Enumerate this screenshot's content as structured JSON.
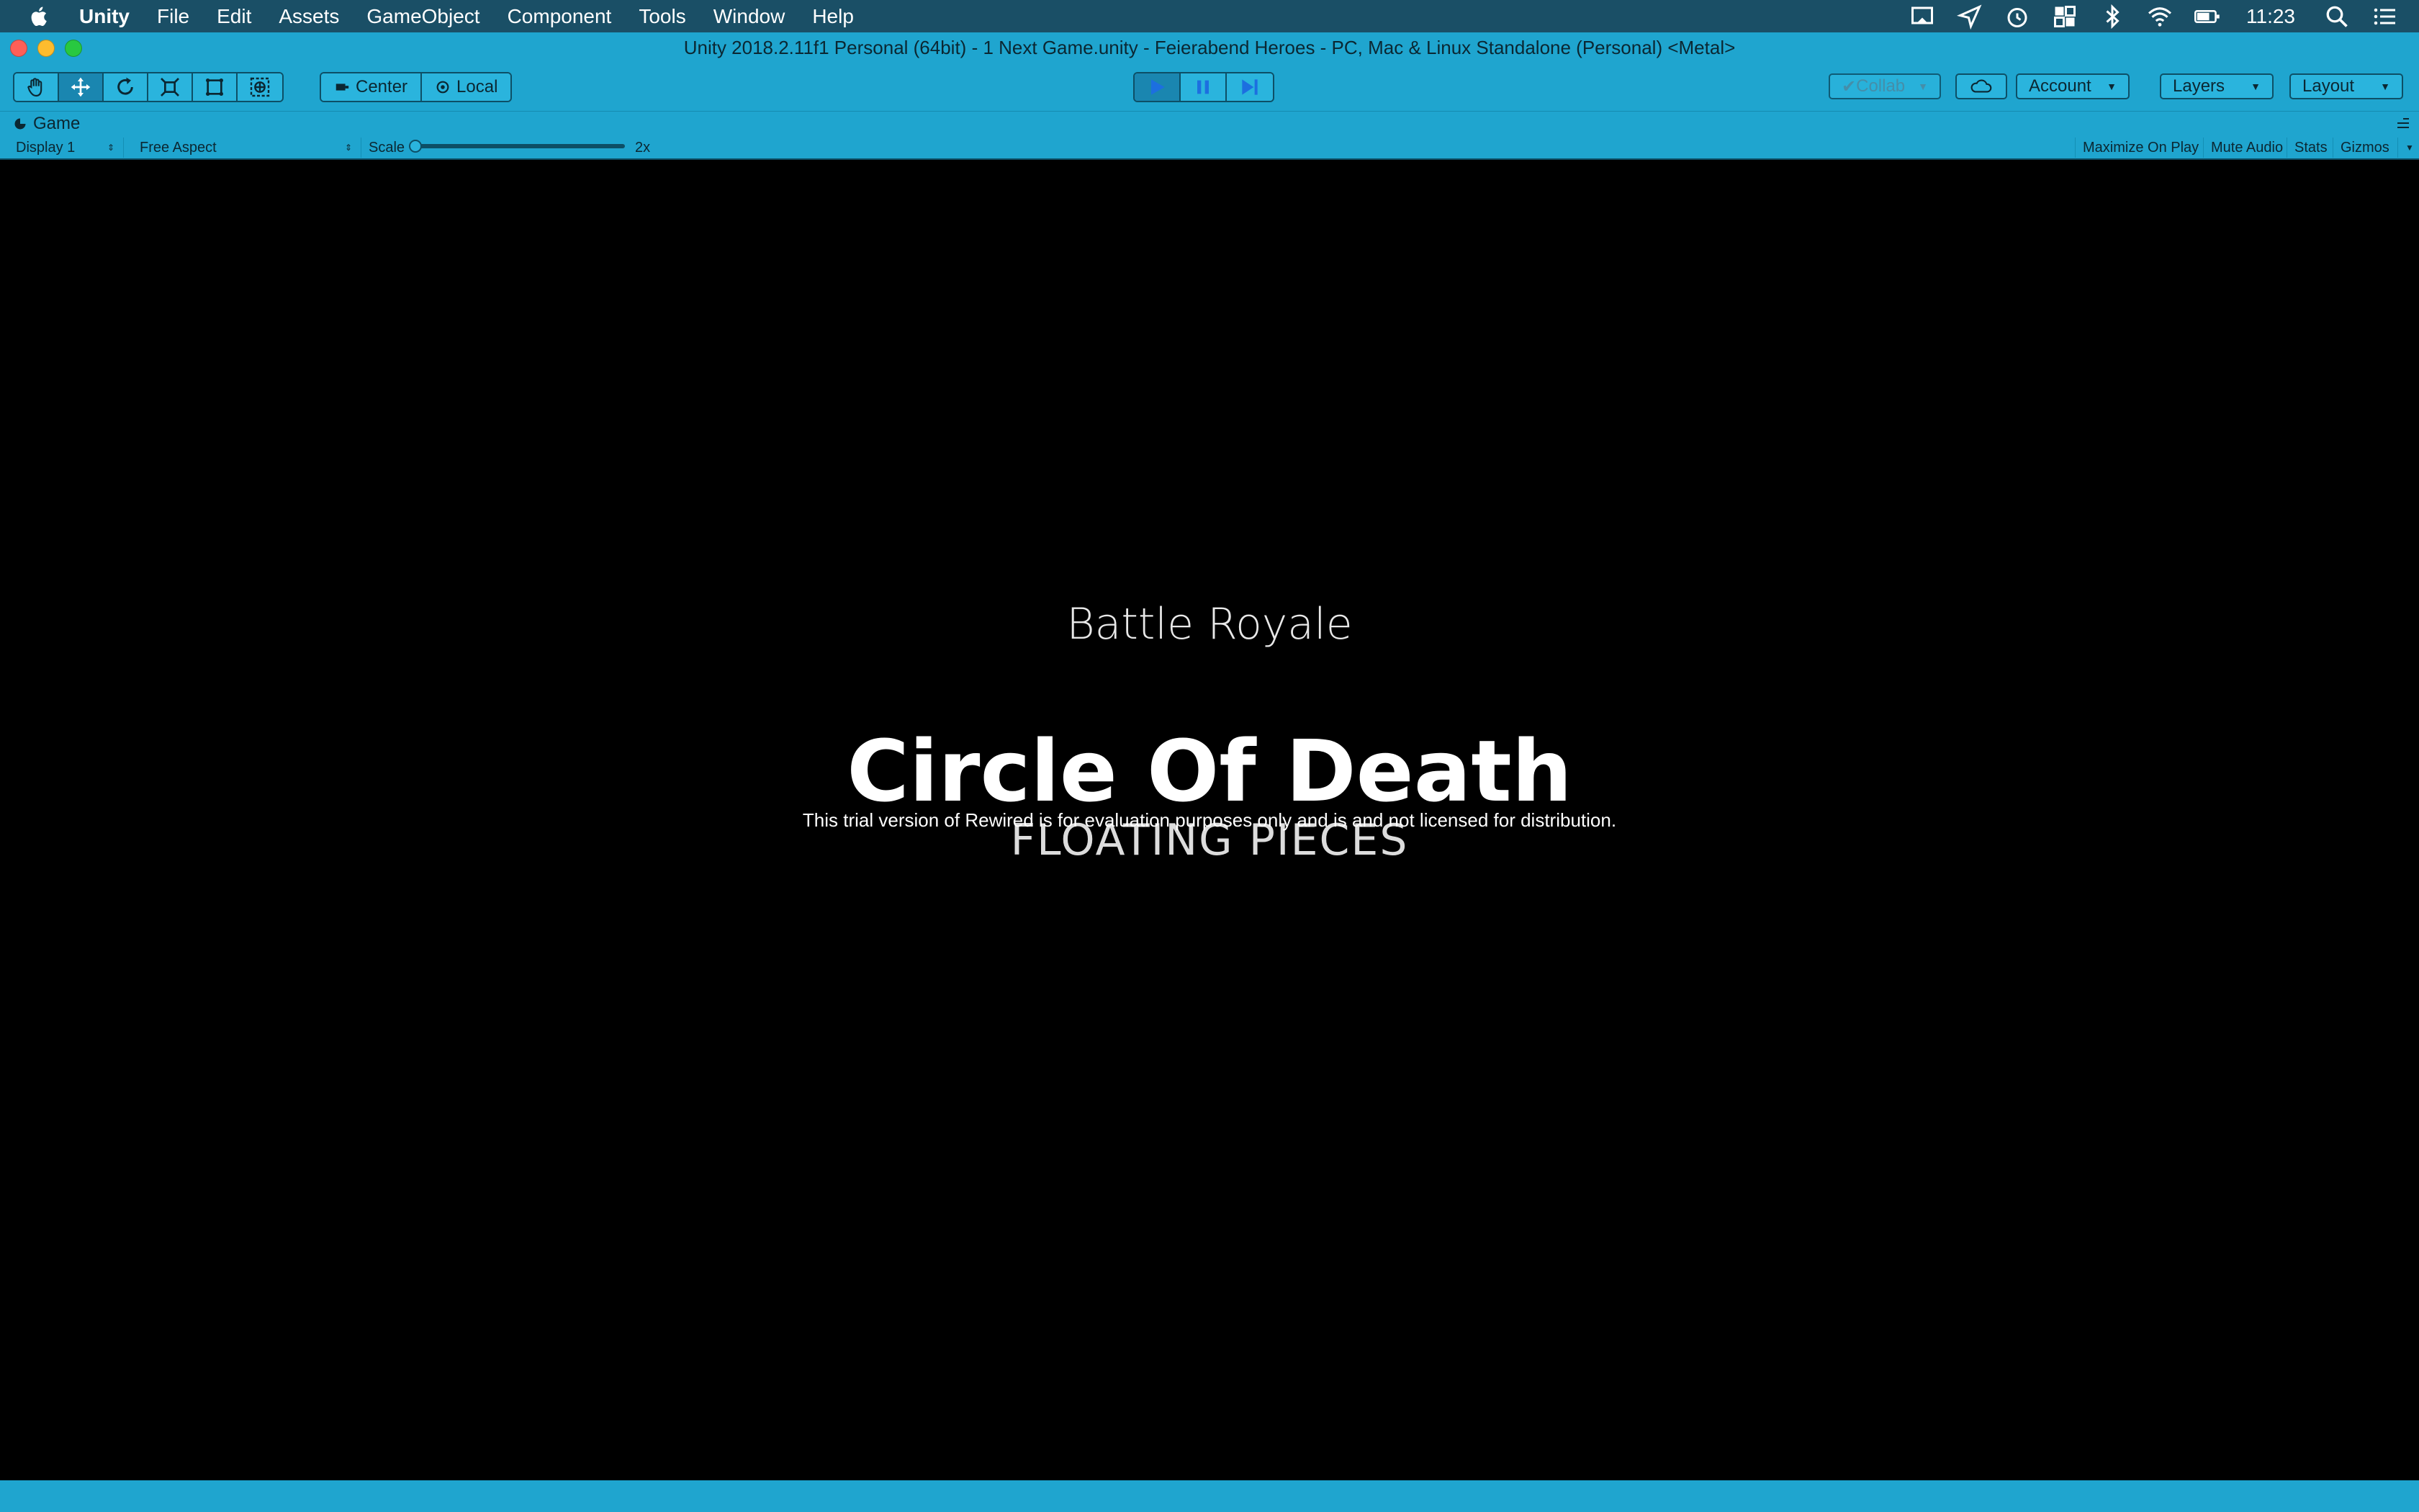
{
  "menubar": {
    "app_name": "Unity",
    "items": [
      "File",
      "Edit",
      "Assets",
      "GameObject",
      "Component",
      "Tools",
      "Window",
      "Help"
    ],
    "clock": "11:23",
    "status_icons": [
      "cast-icon",
      "send-icon",
      "alarm-icon",
      "grid-icon",
      "bluetooth-icon",
      "wifi-icon",
      "battery-icon",
      "search-icon",
      "list-icon"
    ]
  },
  "window": {
    "title": "Unity 2018.2.11f1 Personal (64bit) - 1 Next Game.unity - Feierabend Heroes - PC, Mac & Linux Standalone (Personal) <Metal>"
  },
  "toolbar": {
    "pivot_center": "Center",
    "pivot_local": "Local",
    "collab": "Collab",
    "account": "Account",
    "layers": "Layers",
    "layout": "Layout"
  },
  "game_panel": {
    "tab_label": "Game",
    "display": "Display 1",
    "aspect": "Free Aspect",
    "scale_label": "Scale",
    "scale_value": "2x",
    "scale_level": 0.0,
    "maximize": "Maximize On Play",
    "mute": "Mute Audio",
    "stats": "Stats",
    "gizmos": "Gizmos"
  },
  "game_view": {
    "mode": "Battle Royale",
    "map_name": "Circle Of Death",
    "variant": "FLOATING PIECES",
    "trial_notice": "This trial version of Rewired is for evaluation purposes only and is and not licensed for distribution."
  },
  "colors": {
    "menubar_bg": "#1a4f66",
    "editor_accent": "#1fa5cf",
    "game_bg": "#000000",
    "play_active": "#1a86b0"
  }
}
